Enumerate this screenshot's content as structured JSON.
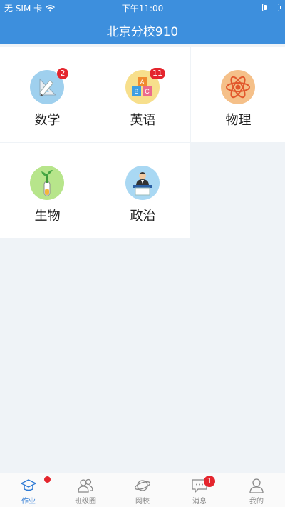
{
  "status": {
    "carrier": "无 SIM 卡",
    "time": "下午11:00",
    "battery_level": 0.25
  },
  "header": {
    "title": "北京分校910"
  },
  "subjects": [
    {
      "label": "数学",
      "icon": "math-ruler-pencil-icon",
      "badge": "2"
    },
    {
      "label": "英语",
      "icon": "abc-blocks-icon",
      "badge": "11"
    },
    {
      "label": "物理",
      "icon": "atom-icon",
      "badge": ""
    },
    {
      "label": "生物",
      "icon": "plant-test-tube-icon",
      "badge": ""
    },
    {
      "label": "政治",
      "icon": "speaker-podium-icon",
      "badge": ""
    }
  ],
  "tabs": [
    {
      "label": "作业",
      "icon": "graduation-cap-icon",
      "active": true,
      "dot": true
    },
    {
      "label": "班级圈",
      "icon": "people-icon"
    },
    {
      "label": "网校",
      "icon": "planet-icon"
    },
    {
      "label": "消息",
      "icon": "chat-bubble-icon",
      "badge": "1"
    },
    {
      "label": "我的",
      "icon": "person-icon"
    }
  ],
  "colors": {
    "header": "#3d8fdd",
    "accent": "#2f7bd5",
    "badge": "#e4252d",
    "background": "#eff3f7"
  }
}
